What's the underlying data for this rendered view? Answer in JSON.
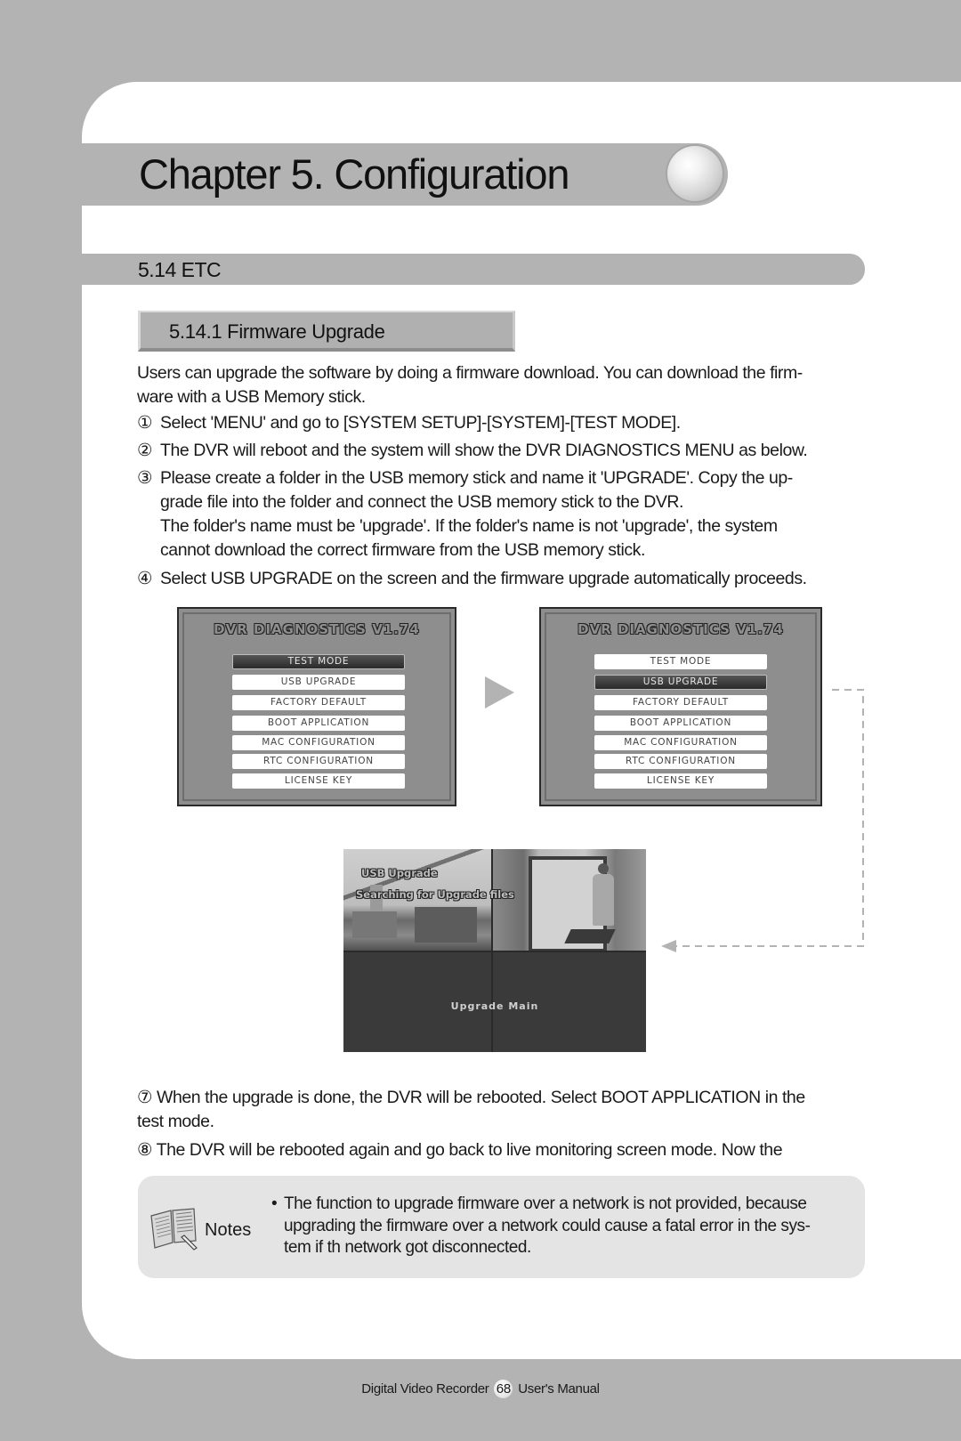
{
  "chapter": {
    "title": "Chapter 5. Configuration"
  },
  "section": {
    "title": "5.14 ETC"
  },
  "subsection": {
    "title": "5.14.1 Firmware Upgrade"
  },
  "intro": {
    "line1": "Users can upgrade the software by doing a firmware download. You can download the firm-",
    "line2": "ware with a USB Memory stick."
  },
  "steps": [
    {
      "num": "①",
      "lines": [
        "Select 'MENU' and go to [SYSTEM SETUP]-[SYSTEM]-[TEST MODE]."
      ]
    },
    {
      "num": "②",
      "lines": [
        "The DVR will reboot and the system will show the DVR DIAGNOSTICS MENU as below."
      ]
    },
    {
      "num": "③",
      "lines": [
        "Please create a folder in the USB memory stick and name it 'UPGRADE'. Copy the up-",
        "grade file into the folder and connect the USB memory stick to the DVR.",
        "The folder's name must be 'upgrade'. If the folder's name is not 'upgrade', the system",
        "cannot download the correct firmware from the USB memory stick."
      ]
    },
    {
      "num": "④",
      "lines": [
        "Select USB UPGRADE on the screen and the firmware upgrade automatically proceeds."
      ]
    }
  ],
  "dvr_screens": [
    {
      "title": "DVR DIAGNOSTICS V1.74",
      "selected_index": 0,
      "items": [
        "TEST MODE",
        "USB UPGRADE",
        "FACTORY DEFAULT",
        "BOOT APPLICATION",
        "MAC CONFIGURATION",
        "RTC CONFIGURATION",
        "LICENSE KEY"
      ]
    },
    {
      "title": "DVR DIAGNOSTICS V1.74",
      "selected_index": 1,
      "items": [
        "TEST MODE",
        "USB UPGRADE",
        "FACTORY DEFAULT",
        "BOOT APPLICATION",
        "MAC CONFIGURATION",
        "RTC CONFIGURATION",
        "LICENSE KEY"
      ]
    }
  ],
  "upgrade_screen": {
    "osd_title": "USB Upgrade",
    "osd_status": "Searching for Upgrade files",
    "main_label": "Upgrade Main"
  },
  "steps_after": [
    {
      "num": "⑦",
      "line1": "When the upgrade is done, the DVR will be rebooted. Select BOOT APPLICATION in the",
      "line2": "test mode."
    },
    {
      "num": "⑧",
      "line1": "The DVR will be rebooted again and go back to live monitoring screen mode. Now the"
    }
  ],
  "notes": {
    "label": "Notes",
    "icon": "open-book-icon",
    "bullet": "•",
    "line1": "The function to upgrade firmware over a network is not provided, because",
    "line2": "upgrading the firmware over a network could cause a fatal error in the sys-",
    "line3": "tem if th network got disconnected."
  },
  "footer": {
    "left": "Digital Video Recorder",
    "page": "68",
    "right": "User's Manual"
  },
  "colors": {
    "page_background": "#b3b3b3",
    "card": "#ffffff",
    "notes_background": "#e4e4e4",
    "text": "#1a1a1a"
  }
}
